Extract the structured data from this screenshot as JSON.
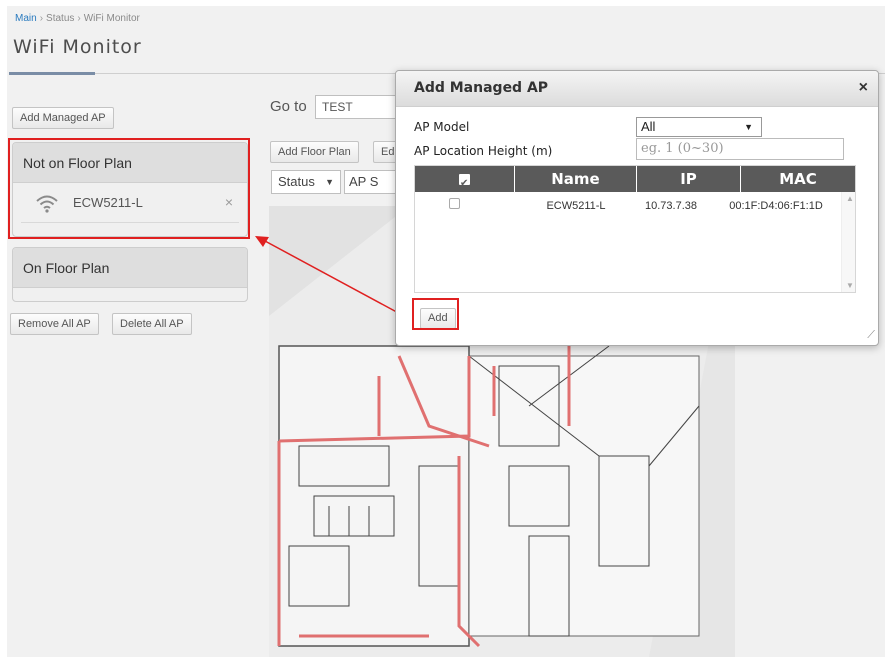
{
  "breadcrumb": {
    "main": "Main",
    "status": "Status",
    "current": "WiFi Monitor",
    "separator": "›"
  },
  "page_title": "WiFi Monitor",
  "left": {
    "add_managed_ap": "Add Managed AP",
    "not_on_floor_plan": "Not on Floor Plan",
    "on_floor_plan": "On Floor Plan",
    "ap_items": [
      {
        "name": "ECW5211-L",
        "remove": "×"
      }
    ],
    "remove_all_ap": "Remove All AP",
    "delete_all_ap": "Delete All AP"
  },
  "toolbar": {
    "goto_label": "Go to",
    "goto_value": "TEST",
    "add_floor_plan": "Add Floor Plan",
    "edit_partial": "Ed",
    "status_select": "Status",
    "aps_partial": "AP S"
  },
  "modal": {
    "title": "Add Managed AP",
    "close": "×",
    "ap_model_label": "AP Model",
    "ap_model_value": "All",
    "height_label": "AP Location Height (m)",
    "height_placeholder": "eg. 1 (0~30)",
    "table": {
      "headers": [
        "Name",
        "IP",
        "MAC"
      ],
      "rows": [
        {
          "name": "ECW5211-L",
          "ip": "10.73.7.38",
          "mac": "00:1F:D4:06:F1:1D"
        }
      ]
    },
    "add_button": "Add"
  },
  "colors": {
    "accent_red": "#e02020",
    "table_header": "#5a5a5a",
    "link_blue": "#2a7bbf"
  }
}
